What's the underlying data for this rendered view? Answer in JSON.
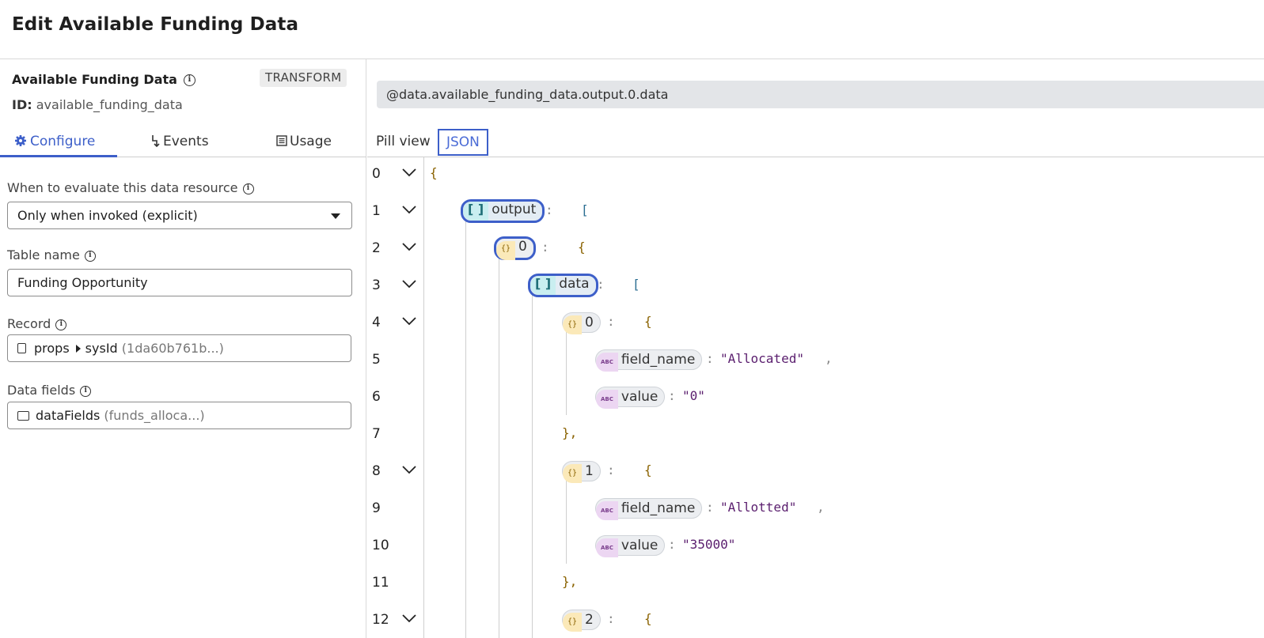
{
  "page": {
    "title": "Edit Available Funding Data"
  },
  "resource": {
    "name": "Available Funding Data",
    "badge": "TRANSFORM",
    "id_label": "ID:",
    "id_value": "available_funding_data"
  },
  "tabs": [
    {
      "label": "Configure",
      "icon": "gear-icon",
      "active": true
    },
    {
      "label": "Events",
      "icon": "lightning-icon",
      "active": false
    },
    {
      "label": "Usage",
      "icon": "list-icon",
      "active": false
    }
  ],
  "fields": {
    "evaluate": {
      "label": "When to evaluate this data resource",
      "value": "Only when invoked (explicit)"
    },
    "table": {
      "label": "Table name",
      "value": "Funding Opportunity"
    },
    "record": {
      "label": "Record",
      "part1": "props",
      "part2": "sysId",
      "hint": "(1da60b761b...)"
    },
    "data_fields": {
      "label": "Data fields",
      "value": "dataFields",
      "hint": "(funds_alloca...)"
    }
  },
  "expression": "@data.available_funding_data.output.0.data",
  "view_tabs": {
    "pill": "Pill view",
    "json": "JSON"
  },
  "code": {
    "line_numbers": [
      "0",
      "1",
      "2",
      "3",
      "4",
      "5",
      "6",
      "7",
      "8",
      "9",
      "10",
      "11",
      "12"
    ],
    "open_brace": "{",
    "open_bracket": "[",
    "close_obj": "},",
    "colon": ":",
    "comma": ",",
    "arr_icon": "[ ]",
    "obj_icon": "{}",
    "abc_icon": "ABC",
    "keys": {
      "output": "output",
      "idx0": "0",
      "data": "data",
      "item0": "0",
      "item1": "1",
      "item2": "2",
      "field_name": "field_name",
      "value": "value"
    },
    "values": {
      "allocated": "\"Allocated\"",
      "zero": "\"0\"",
      "allotted": "\"Allotted\"",
      "amount": "\"35000\""
    }
  },
  "colors": {
    "accent": "#3d5fc9",
    "brace": "#8a6200",
    "string": "#5a1e6e"
  }
}
